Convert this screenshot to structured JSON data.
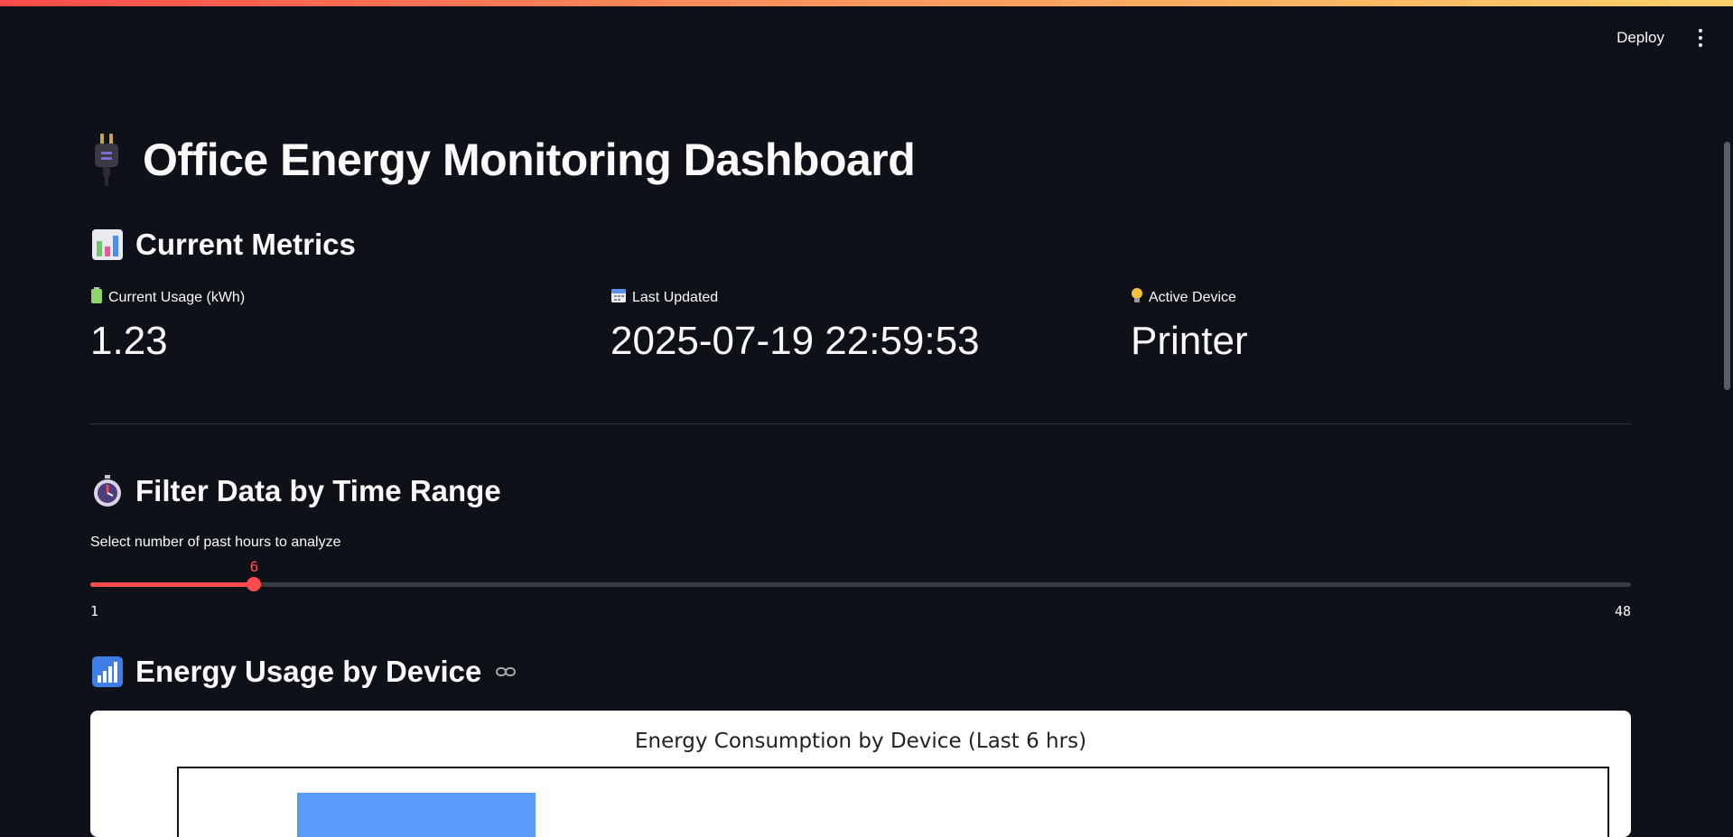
{
  "app": {
    "deploy_label": "Deploy"
  },
  "page": {
    "title": "Office Energy Monitoring Dashboard"
  },
  "current_metrics": {
    "header": "Current Metrics",
    "items": [
      {
        "label": "Current Usage (kWh)",
        "value": "1.23",
        "icon": "battery-icon"
      },
      {
        "label": "Last Updated",
        "value": "2025-07-19 22:59:53",
        "icon": "calendar-icon"
      },
      {
        "label": "Active Device",
        "value": "Printer",
        "icon": "lightbulb-icon"
      }
    ]
  },
  "filter": {
    "header": "Filter Data by Time Range",
    "slider_label": "Select number of past hours to analyze",
    "value": "6",
    "min": "1",
    "max": "48"
  },
  "device_usage": {
    "header": "Energy Usage by Device"
  },
  "chart_data": {
    "type": "bar",
    "title": "Energy Consumption by Device (Last 6 hrs)",
    "bar_color": "#5a9bf7",
    "categories": [],
    "values": []
  },
  "colors": {
    "background": "#0e1117",
    "accent": "#ff4b4b",
    "divider": "#31333f"
  }
}
